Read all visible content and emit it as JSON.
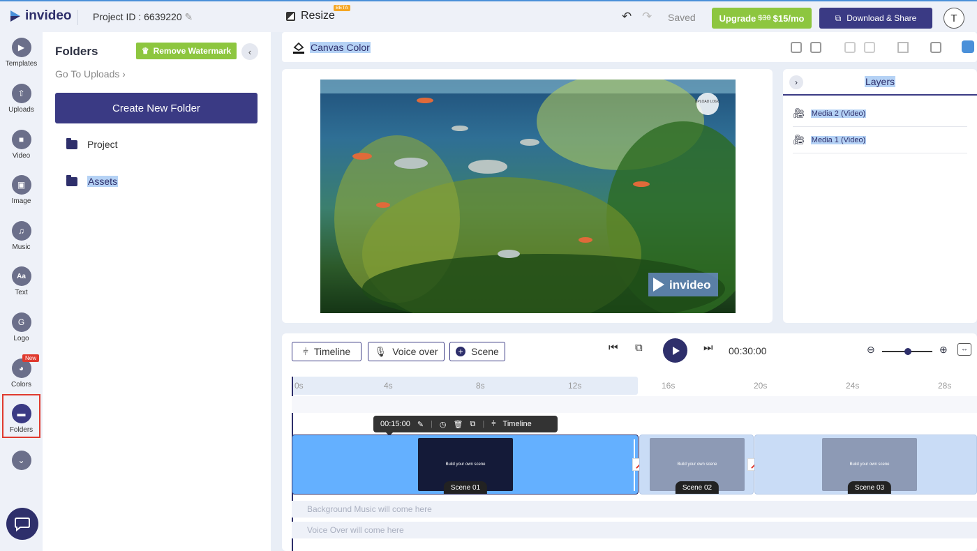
{
  "header": {
    "logo": "invideo",
    "project_id": "Project ID : 6639220",
    "resize_label": "Resize",
    "beta_badge": "BETA",
    "saved": "Saved",
    "upgrade_old": "$30",
    "upgrade_prefix": "Upgrade",
    "upgrade_new": "$15/mo",
    "download": "Download & Share",
    "avatar": "T"
  },
  "rail": [
    {
      "label": "Templates",
      "icon": "templates-icon"
    },
    {
      "label": "Uploads",
      "icon": "upload-icon"
    },
    {
      "label": "Video",
      "icon": "video-camera-icon"
    },
    {
      "label": "Image",
      "icon": "image-icon"
    },
    {
      "label": "Music",
      "icon": "music-note-icon"
    },
    {
      "label": "Text",
      "icon": "text-aa-icon",
      "glyph": "Aa"
    },
    {
      "label": "Logo",
      "icon": "logo-icon"
    },
    {
      "label": "Colors",
      "icon": "palette-icon",
      "badge": "New"
    },
    {
      "label": "Folders",
      "icon": "folder-icon"
    }
  ],
  "folders_panel": {
    "title": "Folders",
    "remove_watermark": "Remove Watermark",
    "goto_uploads": "Go To Uploads ›",
    "create_folder": "Create New Folder",
    "items": [
      "Project",
      "Assets"
    ]
  },
  "canvas_bar": {
    "canvas_color": "Canvas Color"
  },
  "video": {
    "upload_logo": "UPLOAD LOGO",
    "watermark": "invideo"
  },
  "layers": {
    "title": "Layers",
    "items": [
      "Media 2 (Video)",
      "Media 1 (Video)"
    ]
  },
  "timeline": {
    "buttons": [
      "Timeline",
      "Voice over",
      "Scene"
    ],
    "duration": "00:30:00",
    "ticks": [
      "0s",
      "4s",
      "8s",
      "12s",
      "16s",
      "20s",
      "24s",
      "28s"
    ],
    "tooltip": {
      "time": "00:15:00",
      "timeline": "Timeline"
    },
    "scenes": [
      {
        "label": "Scene 01",
        "caption": "Build your own scene"
      },
      {
        "label": "Scene 02",
        "caption": "Build your own scene"
      },
      {
        "label": "Scene 03",
        "caption": "Build your own scene"
      }
    ],
    "bg_music": "Background Music will come here",
    "voice_over": "Voice Over will come here"
  },
  "colors": {
    "brand": "#3a3a84",
    "accent_green": "#8dc63f",
    "selected_scene": "#64b0ff",
    "badge_red": "#e03a2f"
  }
}
